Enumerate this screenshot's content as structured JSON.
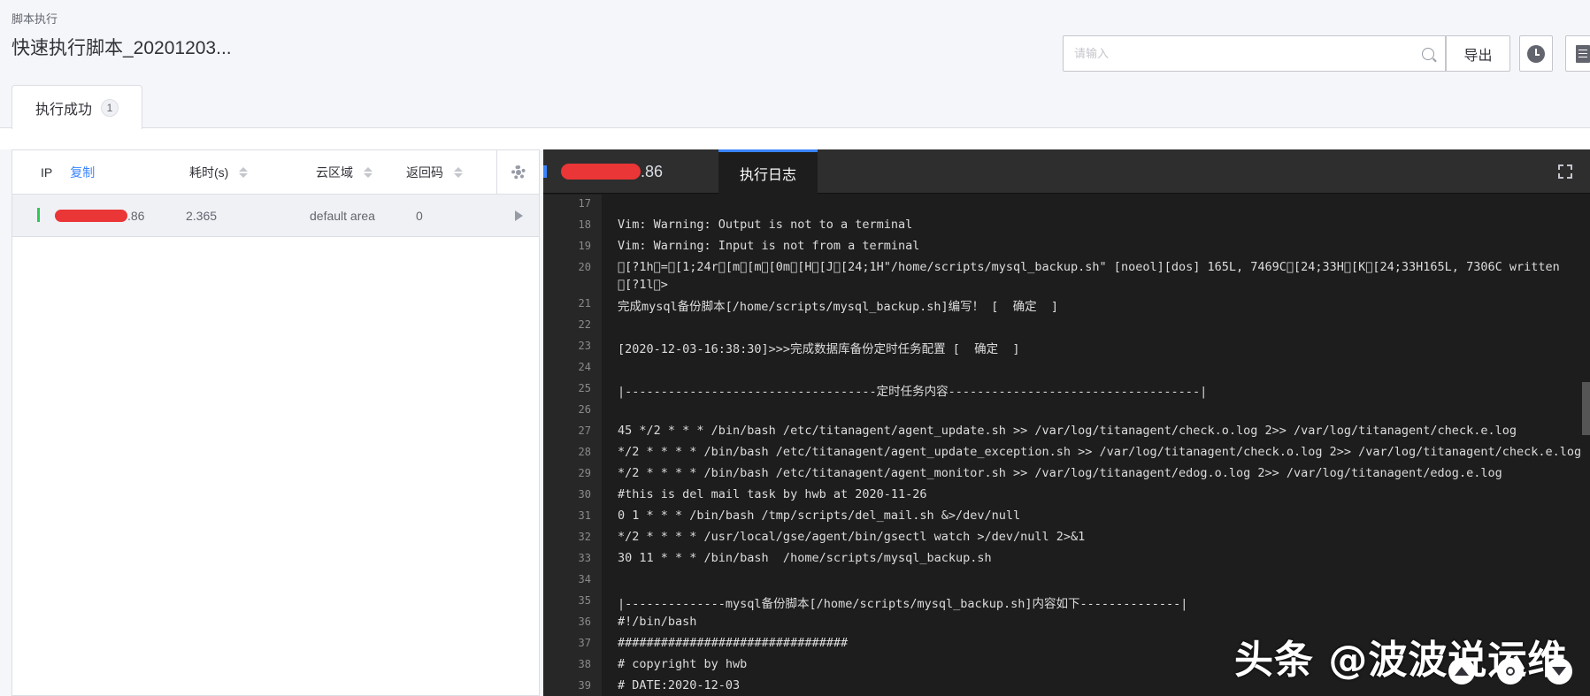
{
  "breadcrumb": "脚本执行",
  "page_title": "快速执行脚本_20201203...",
  "search": {
    "placeholder": "请输入",
    "export_label": "导出"
  },
  "icons": {
    "history": "clock-icon",
    "log": "document-icon",
    "search": "search-icon",
    "settings": "gear-icon",
    "expand": "play-icon",
    "fullscreen": "fullscreen-icon"
  },
  "tabs": [
    {
      "label": "执行成功",
      "count": "1"
    }
  ],
  "table": {
    "headers": {
      "ip": "IP",
      "copy": "复制",
      "duration": "耗时(s)",
      "region": "云区域",
      "code": "返回码"
    },
    "rows": [
      {
        "ip_suffix": ".86",
        "duration": "2.365",
        "region": "default area",
        "code": "0"
      }
    ]
  },
  "log_panel": {
    "host_suffix": ".86",
    "tab_label": "执行日志",
    "lines": [
      {
        "n": "17",
        "t": ""
      },
      {
        "n": "18",
        "t": "Vim: Warning: Output is not to a terminal"
      },
      {
        "n": "19",
        "t": "Vim: Warning: Input is not from a terminal"
      },
      {
        "n": "20",
        "t": "\u0000[?1h\u0000=\u0000[1;24r\u0000[m\u0000[m\u0000[0m\u0000[H\u0000[J\u0000[24;1H\"/home/scripts/mysql_backup.sh\" [noeol][dos] 165L, 7469C\u0000[24;33H\u0000[K\u0000[24;33H165L, 7306C written"
      },
      {
        "n": "",
        "t": "\u0000[?1l\u0000>"
      },
      {
        "n": "21",
        "t": "完成mysql备份脚本[/home/scripts/mysql_backup.sh]编写！ [  确定  ]"
      },
      {
        "n": "22",
        "t": ""
      },
      {
        "n": "23",
        "t": "[2020-12-03-16:38:30]>>>完成数据库备份定时任务配置 [  确定  ]"
      },
      {
        "n": "24",
        "t": ""
      },
      {
        "n": "25",
        "t": "|-----------------------------------定时任务内容-----------------------------------|"
      },
      {
        "n": "26",
        "t": ""
      },
      {
        "n": "27",
        "t": "45 */2 * * * /bin/bash /etc/titanagent/agent_update.sh >> /var/log/titanagent/check.o.log 2>> /var/log/titanagent/check.e.log"
      },
      {
        "n": "28",
        "t": "*/2 * * * * /bin/bash /etc/titanagent/agent_update_exception.sh >> /var/log/titanagent/check.o.log 2>> /var/log/titanagent/check.e.log"
      },
      {
        "n": "29",
        "t": "*/2 * * * * /bin/bash /etc/titanagent/agent_monitor.sh >> /var/log/titanagent/edog.o.log 2>> /var/log/titanagent/edog.e.log"
      },
      {
        "n": "30",
        "t": "#this is del mail task by hwb at 2020-11-26"
      },
      {
        "n": "31",
        "t": "0 1 * * * /bin/bash /tmp/scripts/del_mail.sh &>/dev/null"
      },
      {
        "n": "32",
        "t": "*/2 * * * * /usr/local/gse/agent/bin/gsectl watch >/dev/null 2>&1"
      },
      {
        "n": "33",
        "t": "30 11 * * * /bin/bash  /home/scripts/mysql_backup.sh"
      },
      {
        "n": "34",
        "t": ""
      },
      {
        "n": "35",
        "t": "|--------------mysql备份脚本[/home/scripts/mysql_backup.sh]内容如下--------------|"
      },
      {
        "n": "36",
        "t": "#!/bin/bash"
      },
      {
        "n": "37",
        "t": "################################"
      },
      {
        "n": "38",
        "t": "# copyright by hwb"
      },
      {
        "n": "39",
        "t": "# DATE:2020-12-03"
      }
    ]
  },
  "watermark": "头条 @波波说运维"
}
